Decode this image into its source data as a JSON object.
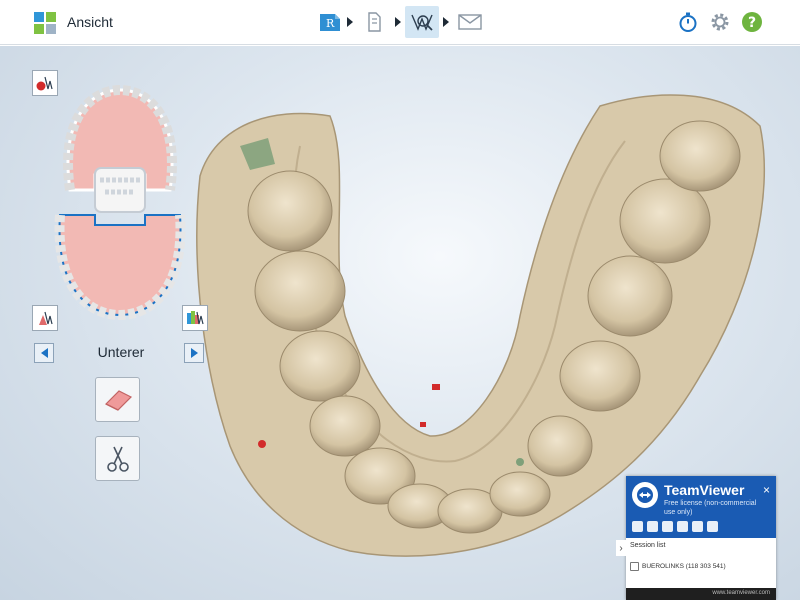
{
  "app": {
    "title": "Ansicht"
  },
  "workflow": {
    "rx_letter": "R"
  },
  "left_panel": {
    "jaw_label": "Unterer"
  },
  "teamviewer": {
    "name": "TeamViewer",
    "license": "Free license (non-commercial use only)",
    "close": "×",
    "section": "Session list",
    "session": "BUEROLINKS (118 303 541)",
    "footer": "www.teamviewer.com"
  },
  "colors": {
    "accent": "#1b72c4",
    "teamviewer_blue": "#1a5bb3",
    "gum_pink": "#f2b9b4",
    "scan_beige": "#d8c9aa"
  }
}
